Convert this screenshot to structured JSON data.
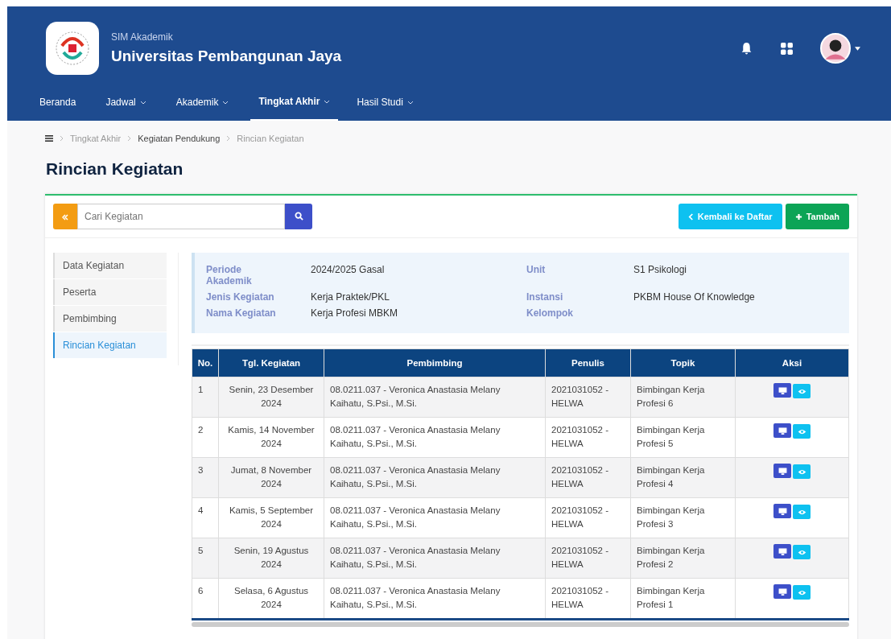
{
  "header": {
    "subtitle": "SIM Akademik",
    "title": "Universitas Pembangunan Jaya"
  },
  "nav": [
    {
      "label": "Beranda",
      "dropdown": false,
      "selected": false
    },
    {
      "label": "Jadwal",
      "dropdown": true,
      "selected": false
    },
    {
      "label": "Akademik",
      "dropdown": true,
      "selected": false
    },
    {
      "label": "Tingkat Akhir",
      "dropdown": true,
      "selected": true
    },
    {
      "label": "Hasil Studi",
      "dropdown": true,
      "selected": false
    }
  ],
  "breadcrumb": [
    {
      "label": "Tingkat Akhir",
      "dim": true
    },
    {
      "label": "Kegiatan Pendukung",
      "dim": false
    },
    {
      "label": "Rincian Kegiatan",
      "dim": true
    }
  ],
  "page_title": "Rincian Kegiatan",
  "search": {
    "placeholder": "Cari Kegiatan"
  },
  "buttons": [
    {
      "label": "Kembali ke Daftar",
      "kind": "back"
    },
    {
      "label": "Tambah",
      "kind": "add"
    }
  ],
  "side_menu": [
    {
      "label": "Data Kegiatan",
      "selected": false
    },
    {
      "label": "Peserta",
      "selected": false
    },
    {
      "label": "Pembimbing",
      "selected": false
    },
    {
      "label": "Rincian Kegiatan",
      "selected": true
    }
  ],
  "info": [
    {
      "label": "Periode Akademik",
      "value": "2024/2025 Gasal"
    },
    {
      "label": "Unit",
      "value": "S1 Psikologi"
    },
    {
      "label": "Jenis Kegiatan",
      "value": "Kerja Praktek/PKL"
    },
    {
      "label": "Instansi",
      "value": "PKBM House Of Knowledge"
    },
    {
      "label": "Nama Kegiatan",
      "value": "Kerja Profesi MBKM"
    },
    {
      "label": "Kelompok"
    }
  ],
  "table": {
    "columns": [
      "No.",
      "Tgl. Kegiatan",
      "Pembimbing",
      "Penulis",
      "Topik",
      "Aksi"
    ],
    "rows": [
      {
        "no": "1",
        "date": "Senin, 23 Desember 2024",
        "pembimbing": "08.0211.037 - Veronica Anastasia Melany Kaihatu, S.Psi., M.Si.",
        "penulis": "2021031052 - HELWA",
        "topik": "Bimbingan Kerja Profesi 6"
      },
      {
        "no": "2",
        "date": "Kamis, 14 November 2024",
        "pembimbing": "08.0211.037 - Veronica Anastasia Melany Kaihatu, S.Psi., M.Si.",
        "penulis": "2021031052 - HELWA",
        "topik": "Bimbingan Kerja Profesi 5"
      },
      {
        "no": "3",
        "date": "Jumat, 8 November 2024",
        "pembimbing": "08.0211.037 - Veronica Anastasia Melany Kaihatu, S.Psi., M.Si.",
        "penulis": "2021031052 - HELWA",
        "topik": "Bimbingan Kerja Profesi 4"
      },
      {
        "no": "4",
        "date": "Kamis, 5 September 2024",
        "pembimbing": "08.0211.037 - Veronica Anastasia Melany Kaihatu, S.Psi., M.Si.",
        "penulis": "2021031052 - HELWA",
        "topik": "Bimbingan Kerja Profesi 3"
      },
      {
        "no": "5",
        "date": "Senin, 19 Agustus 2024",
        "pembimbing": "08.0211.037 - Veronica Anastasia Melany Kaihatu, S.Psi., M.Si.",
        "penulis": "2021031052 - HELWA",
        "topik": "Bimbingan Kerja Profesi 2"
      },
      {
        "no": "6",
        "date": "Selasa, 6 Agustus 2024",
        "pembimbing": "08.0211.037 - Veronica Anastasia Melany Kaihatu, S.Psi., M.Si.",
        "penulis": "2021031052 - HELWA",
        "topik": "Bimbingan Kerja Profesi 1"
      }
    ]
  }
}
